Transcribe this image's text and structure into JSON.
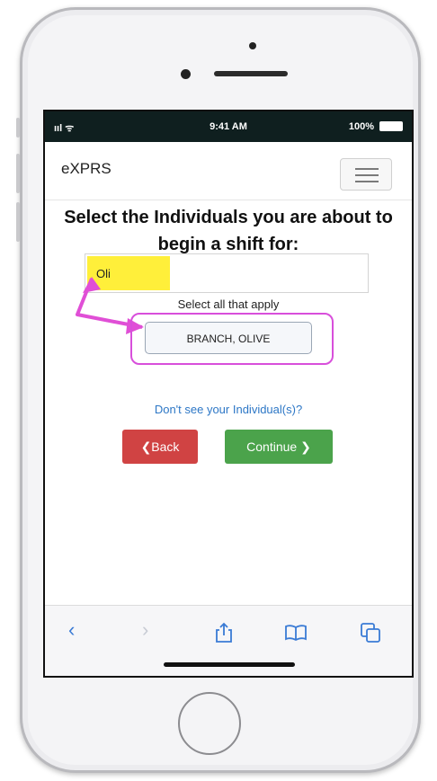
{
  "status": {
    "signal": "ııl ᯤ",
    "time": "9:41 AM",
    "battery": "100%"
  },
  "app": {
    "brand": "eXPRS",
    "heading": "Select the Individuals you are about to begin a shift for:"
  },
  "search": {
    "value": "Oli"
  },
  "hint": "Select all that apply",
  "results": [
    {
      "label": "BRANCH, OLIVE"
    }
  ],
  "link": "Don't see your Individual(s)?",
  "buttons": {
    "back": "❮Back",
    "continue": "Continue ❯"
  },
  "annotation_colors": {
    "highlight": "#ffef3a",
    "arrow": "#e04fd6",
    "box": "#d84fdb"
  },
  "toolbar_icons": [
    "back-icon",
    "forward-icon",
    "share-icon",
    "bookmarks-icon",
    "tabs-icon"
  ]
}
